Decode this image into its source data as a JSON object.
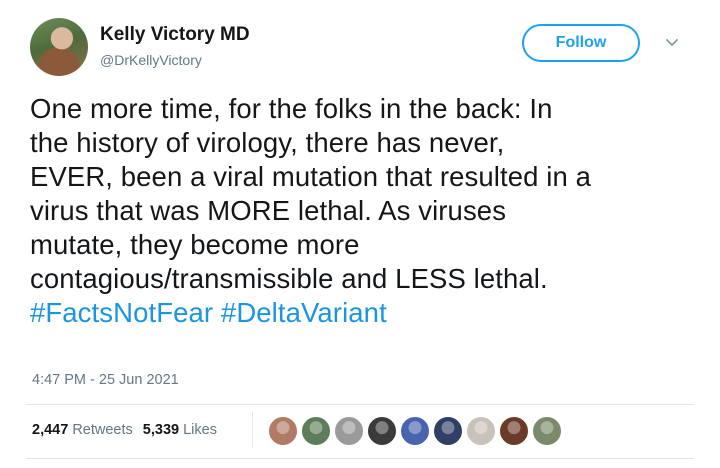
{
  "author": {
    "name": "Kelly Victory MD",
    "handle": "@DrKellyVictory"
  },
  "follow_label": "Follow",
  "tweet": {
    "line1": "One more time, for the folks in the back: In",
    "line2": "the history of virology, there has never,",
    "line3": "EVER, been a viral mutation that resulted in a",
    "line4": "virus that was MORE lethal. As viruses",
    "line5": "mutate, they become more",
    "line6": "contagious/transmissible and LESS lethal.",
    "hashtag1": "#FactsNotFear",
    "hashtag2": "#DeltaVariant"
  },
  "timestamp": "4:47 PM - 25 Jun 2021",
  "stats": {
    "retweets_count": "2,447",
    "retweets_label": "Retweets",
    "likes_count": "5,339",
    "likes_label": "Likes"
  },
  "likers": [
    {
      "icon": "avatar-1",
      "color": "#b07a64"
    },
    {
      "icon": "avatar-2",
      "color": "#5e7d5a"
    },
    {
      "icon": "avatar-3",
      "color": "#9a9a9a"
    },
    {
      "icon": "avatar-4",
      "color": "#3b3b3b"
    },
    {
      "icon": "avatar-5",
      "color": "#4a63b0"
    },
    {
      "icon": "avatar-6",
      "color": "#2f3f66"
    },
    {
      "icon": "avatar-7",
      "color": "#c9c2b8"
    },
    {
      "icon": "avatar-8",
      "color": "#6b3b2a"
    },
    {
      "icon": "avatar-9",
      "color": "#7a8a6a"
    }
  ]
}
